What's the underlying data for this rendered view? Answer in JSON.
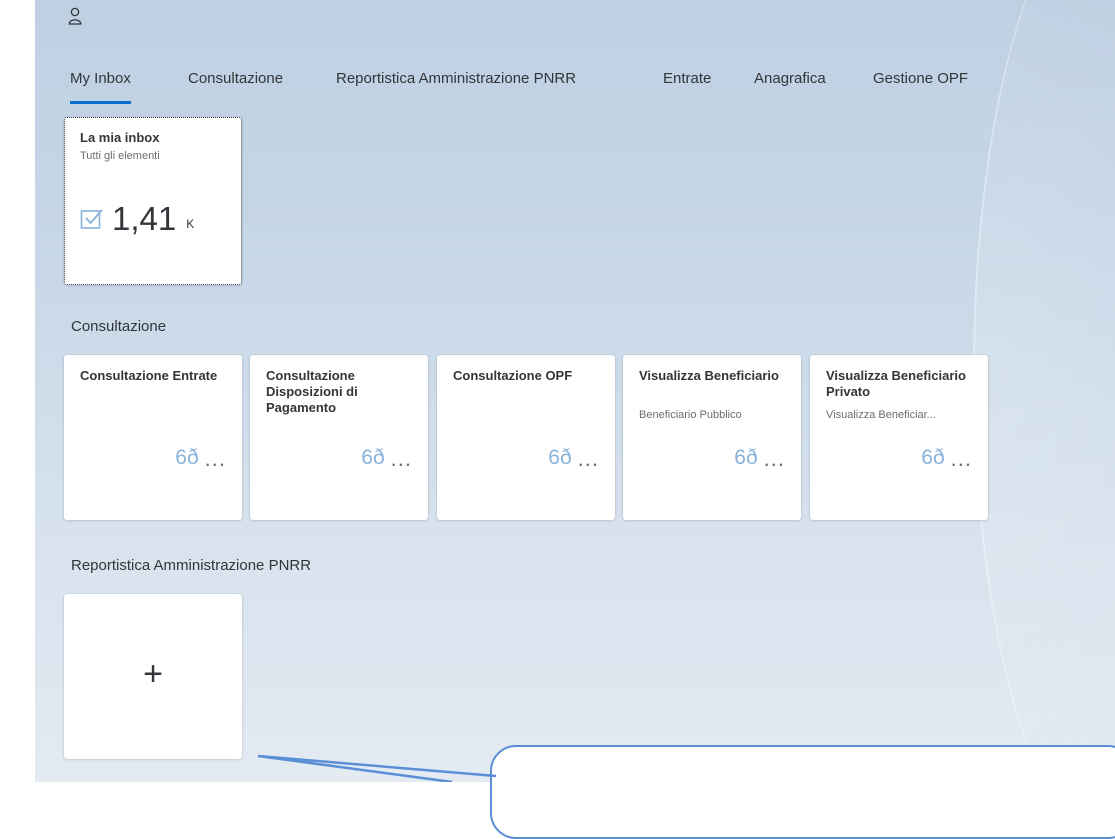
{
  "tabs": [
    {
      "label": "My Inbox",
      "active": true
    },
    {
      "label": "Consultazione",
      "active": false
    },
    {
      "label": "Reportistica Amministrazione PNRR",
      "active": false
    },
    {
      "label": "Entrate",
      "active": false
    },
    {
      "label": "Anagrafica",
      "active": false
    },
    {
      "label": "Gestione OPF",
      "active": false
    }
  ],
  "inbox_tile": {
    "title": "La mia inbox",
    "subtitle": "Tutti gli elementi",
    "value": "1,41",
    "scale": "K",
    "icon": "checkbox-icon"
  },
  "groups": {
    "consultazione": {
      "title": "Consultazione",
      "tiles": [
        {
          "title": "Consultazione Entrate",
          "subtitle": "",
          "icon": "glasses-icon",
          "more": "..."
        },
        {
          "title": "Consultazione Disposizioni di Pagamento",
          "subtitle": "",
          "icon": "glasses-icon",
          "more": "..."
        },
        {
          "title": "Consultazione OPF",
          "subtitle": "",
          "icon": "glasses-icon",
          "more": "..."
        },
        {
          "title": "Visualizza Beneficiario",
          "subtitle": "Beneficiario Pubblico",
          "icon": "glasses-icon",
          "more": "..."
        },
        {
          "title": "Visualizza Beneficiario Privato",
          "subtitle": "Visualizza Beneficiar...",
          "icon": "glasses-icon",
          "more": "..."
        }
      ]
    },
    "reportistica": {
      "title": "Reportistica Amministrazione PNRR",
      "add_tile_label": "+"
    }
  },
  "colors": {
    "accent": "#0a6ed1",
    "icon_blue": "#89b3da",
    "text": "#32363a",
    "callout_border": "#5a8fd6"
  }
}
